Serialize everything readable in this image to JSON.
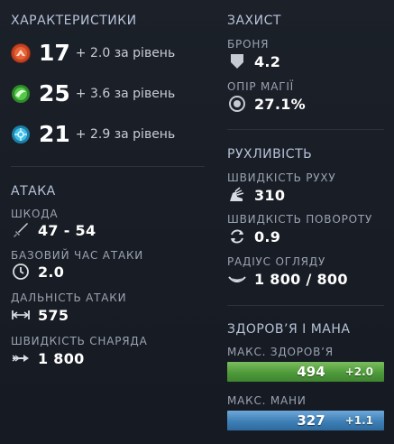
{
  "attributes": {
    "title": "ХАРАКТЕРИСТИКИ",
    "strength": {
      "value": "17",
      "gain": "+ 2.0 за рівень",
      "color": "#e0552e",
      "icon": "strength-icon"
    },
    "agility": {
      "value": "25",
      "gain": "+ 3.6 за рівень",
      "color": "#3fb43a",
      "icon": "agility-icon"
    },
    "intelligence": {
      "value": "21",
      "gain": "+ 2.9 за рівень",
      "color": "#2ea8d6",
      "icon": "intelligence-icon"
    }
  },
  "attack": {
    "title": "АТАКА",
    "damage": {
      "label": "ШКОДА",
      "value": "47 - 54",
      "icon": "sword-icon"
    },
    "attack_time": {
      "label": "БАЗОВИЙ ЧАС АТАКИ",
      "value": "2.0",
      "icon": "clock-icon"
    },
    "range": {
      "label": "ДАЛЬНІСТЬ АТАКИ",
      "value": "575",
      "icon": "range-icon"
    },
    "projectile": {
      "label": "ШВИДКІСТЬ СНАРЯДА",
      "value": "1 800",
      "icon": "arrow-icon"
    }
  },
  "defense": {
    "title": "ЗАХИСТ",
    "armor": {
      "label": "БРОНЯ",
      "value": "4.2",
      "icon": "shield-icon"
    },
    "magic_resist": {
      "label": "ОПІР МАГІЇ",
      "value": "27.1%",
      "icon": "magic-resist-icon"
    }
  },
  "mobility": {
    "title": "РУХЛИВІСТЬ",
    "move_speed": {
      "label": "ШВИДКІСТЬ РУХУ",
      "value": "310",
      "icon": "winged-boot-icon"
    },
    "turn_rate": {
      "label": "ШВИДКІСТЬ ПОВОРОТУ",
      "value": "0.9",
      "icon": "rotate-icon"
    },
    "vision": {
      "label": "РАДІУС ОГЛЯДУ",
      "value": "1 800 / 800",
      "icon": "eye-icon"
    }
  },
  "health_mana": {
    "title": "ЗДОРОВ’Я І МАНА",
    "health": {
      "label": "МАКС. ЗДОРОВ’Я",
      "value": "494",
      "regen": "+2.0",
      "color": "#4e9a3a"
    },
    "mana": {
      "label": "МАКС. МАНИ",
      "value": "327",
      "regen": "+1.1",
      "color": "#3d7fb6"
    }
  }
}
